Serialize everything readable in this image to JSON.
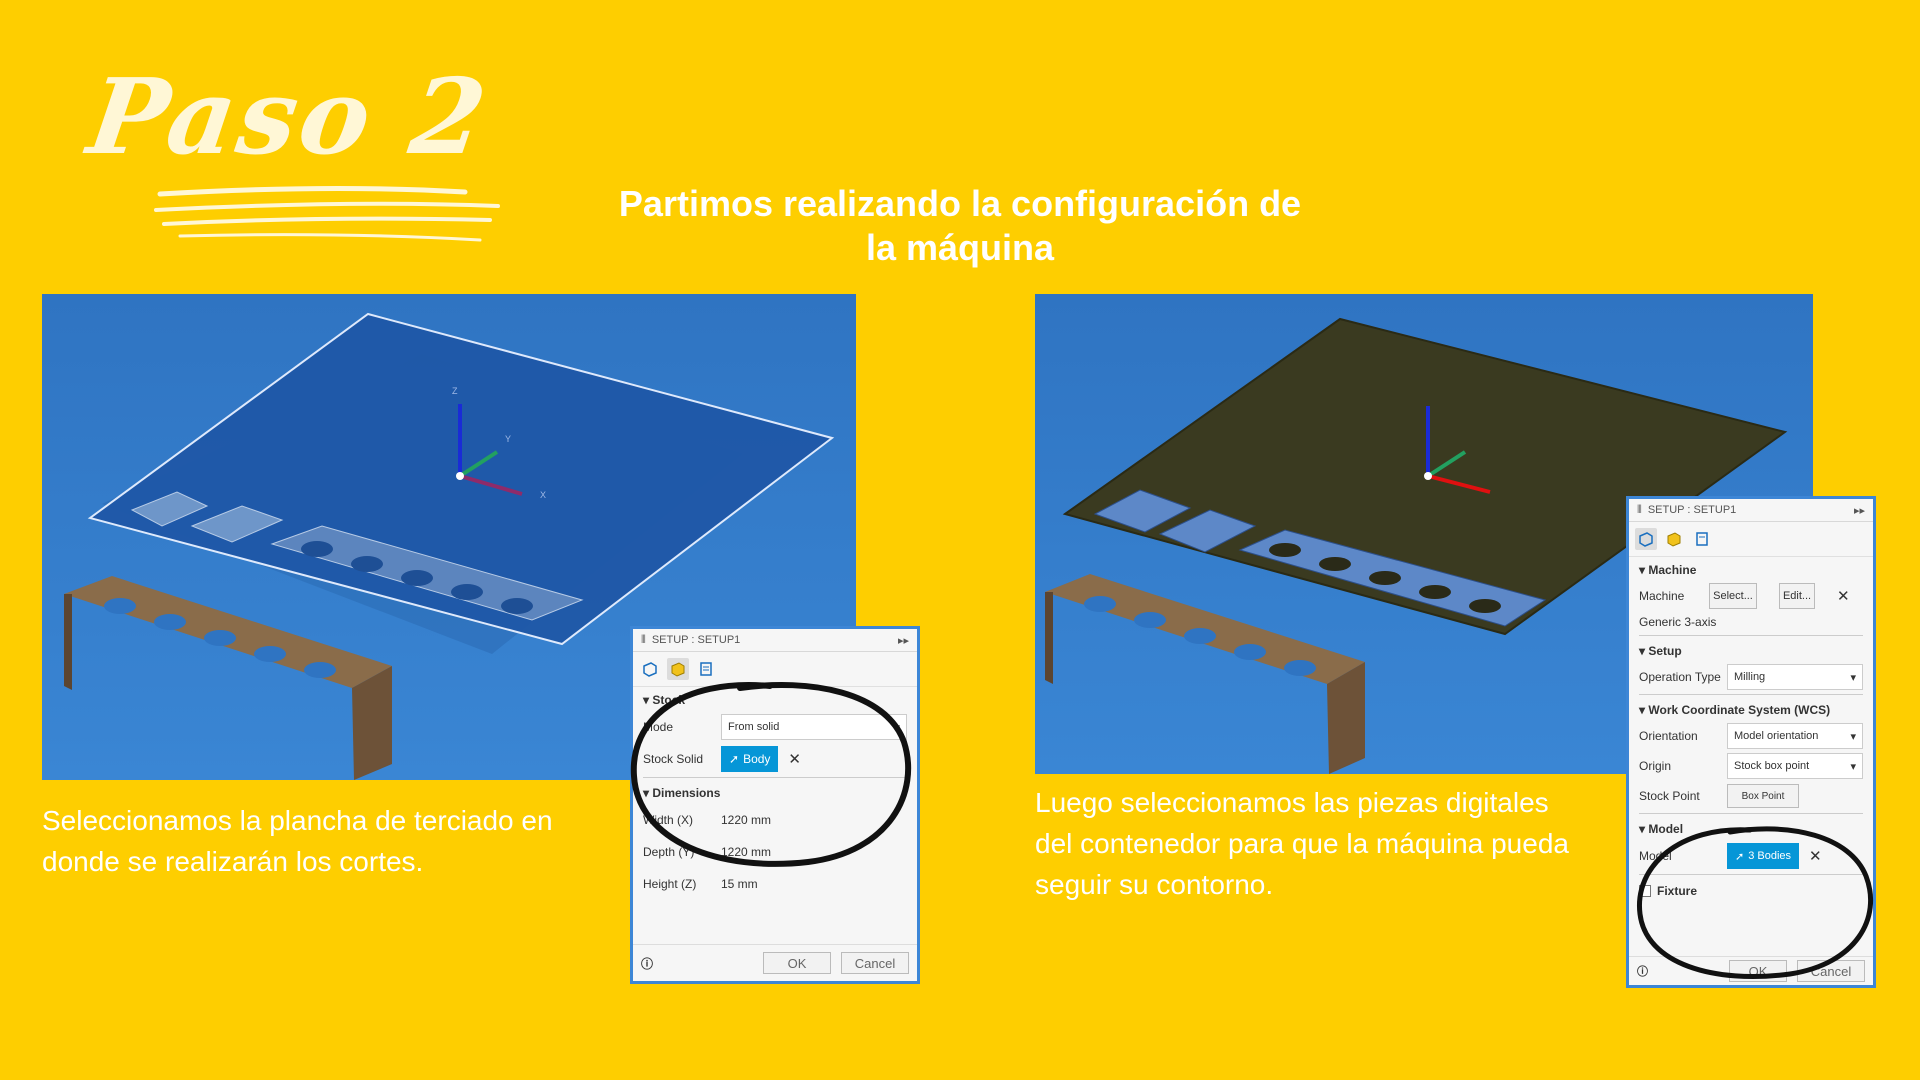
{
  "step_title": "Paso 2",
  "headline": {
    "line1": "Partimos  realizando la configuración de",
    "line2": "la máquina"
  },
  "captions": {
    "left": "Seleccionamos la plancha de terciado en donde se realizarán los cortes.",
    "right": "Luego seleccionamos las piezas digitales del contenedor para que la máquina pueda seguir su contorno."
  },
  "dialog_left": {
    "title": "SETUP : SETUP1",
    "tabs": [
      "setup-tab-icon",
      "stock-tab-icon",
      "post-tab-icon"
    ],
    "stock_section": "Stock",
    "mode_label": "Mode",
    "mode_value": "From solid",
    "stock_solid_label": "Stock Solid",
    "stock_solid_value": "Body",
    "dimensions_section": "Dimensions",
    "width_label": "Width (X)",
    "width_value": "1220 mm",
    "depth_label": "Depth (Y)",
    "depth_value": "1220 mm",
    "height_label": "Height (Z)",
    "height_value": "15 mm",
    "ok": "OK",
    "cancel": "Cancel"
  },
  "dialog_right": {
    "title": "SETUP : SETUP1",
    "machine_section": "Machine",
    "machine_label": "Machine",
    "select_label": "Select...",
    "edit_label": "Edit...",
    "machine_name": "Generic 3-axis",
    "setup_section": "Setup",
    "op_type_label": "Operation Type",
    "op_type_value": "Milling",
    "wcs_section": "Work Coordinate System (WCS)",
    "orientation_label": "Orientation",
    "orientation_value": "Model orientation",
    "origin_label": "Origin",
    "origin_value": "Stock box point",
    "stock_point_label": "Stock Point",
    "stock_point_value": "Box Point",
    "model_section": "Model",
    "model_label": "Model",
    "model_value": "3 Bodies",
    "fixture_label": "Fixture",
    "ok": "OK",
    "cancel": "Cancel"
  },
  "axes": {
    "x": "X",
    "y": "Y",
    "z": "Z"
  },
  "colors": {
    "background": "#FECE00",
    "accent": "#0696D7",
    "viewport": "#3A86D4"
  }
}
